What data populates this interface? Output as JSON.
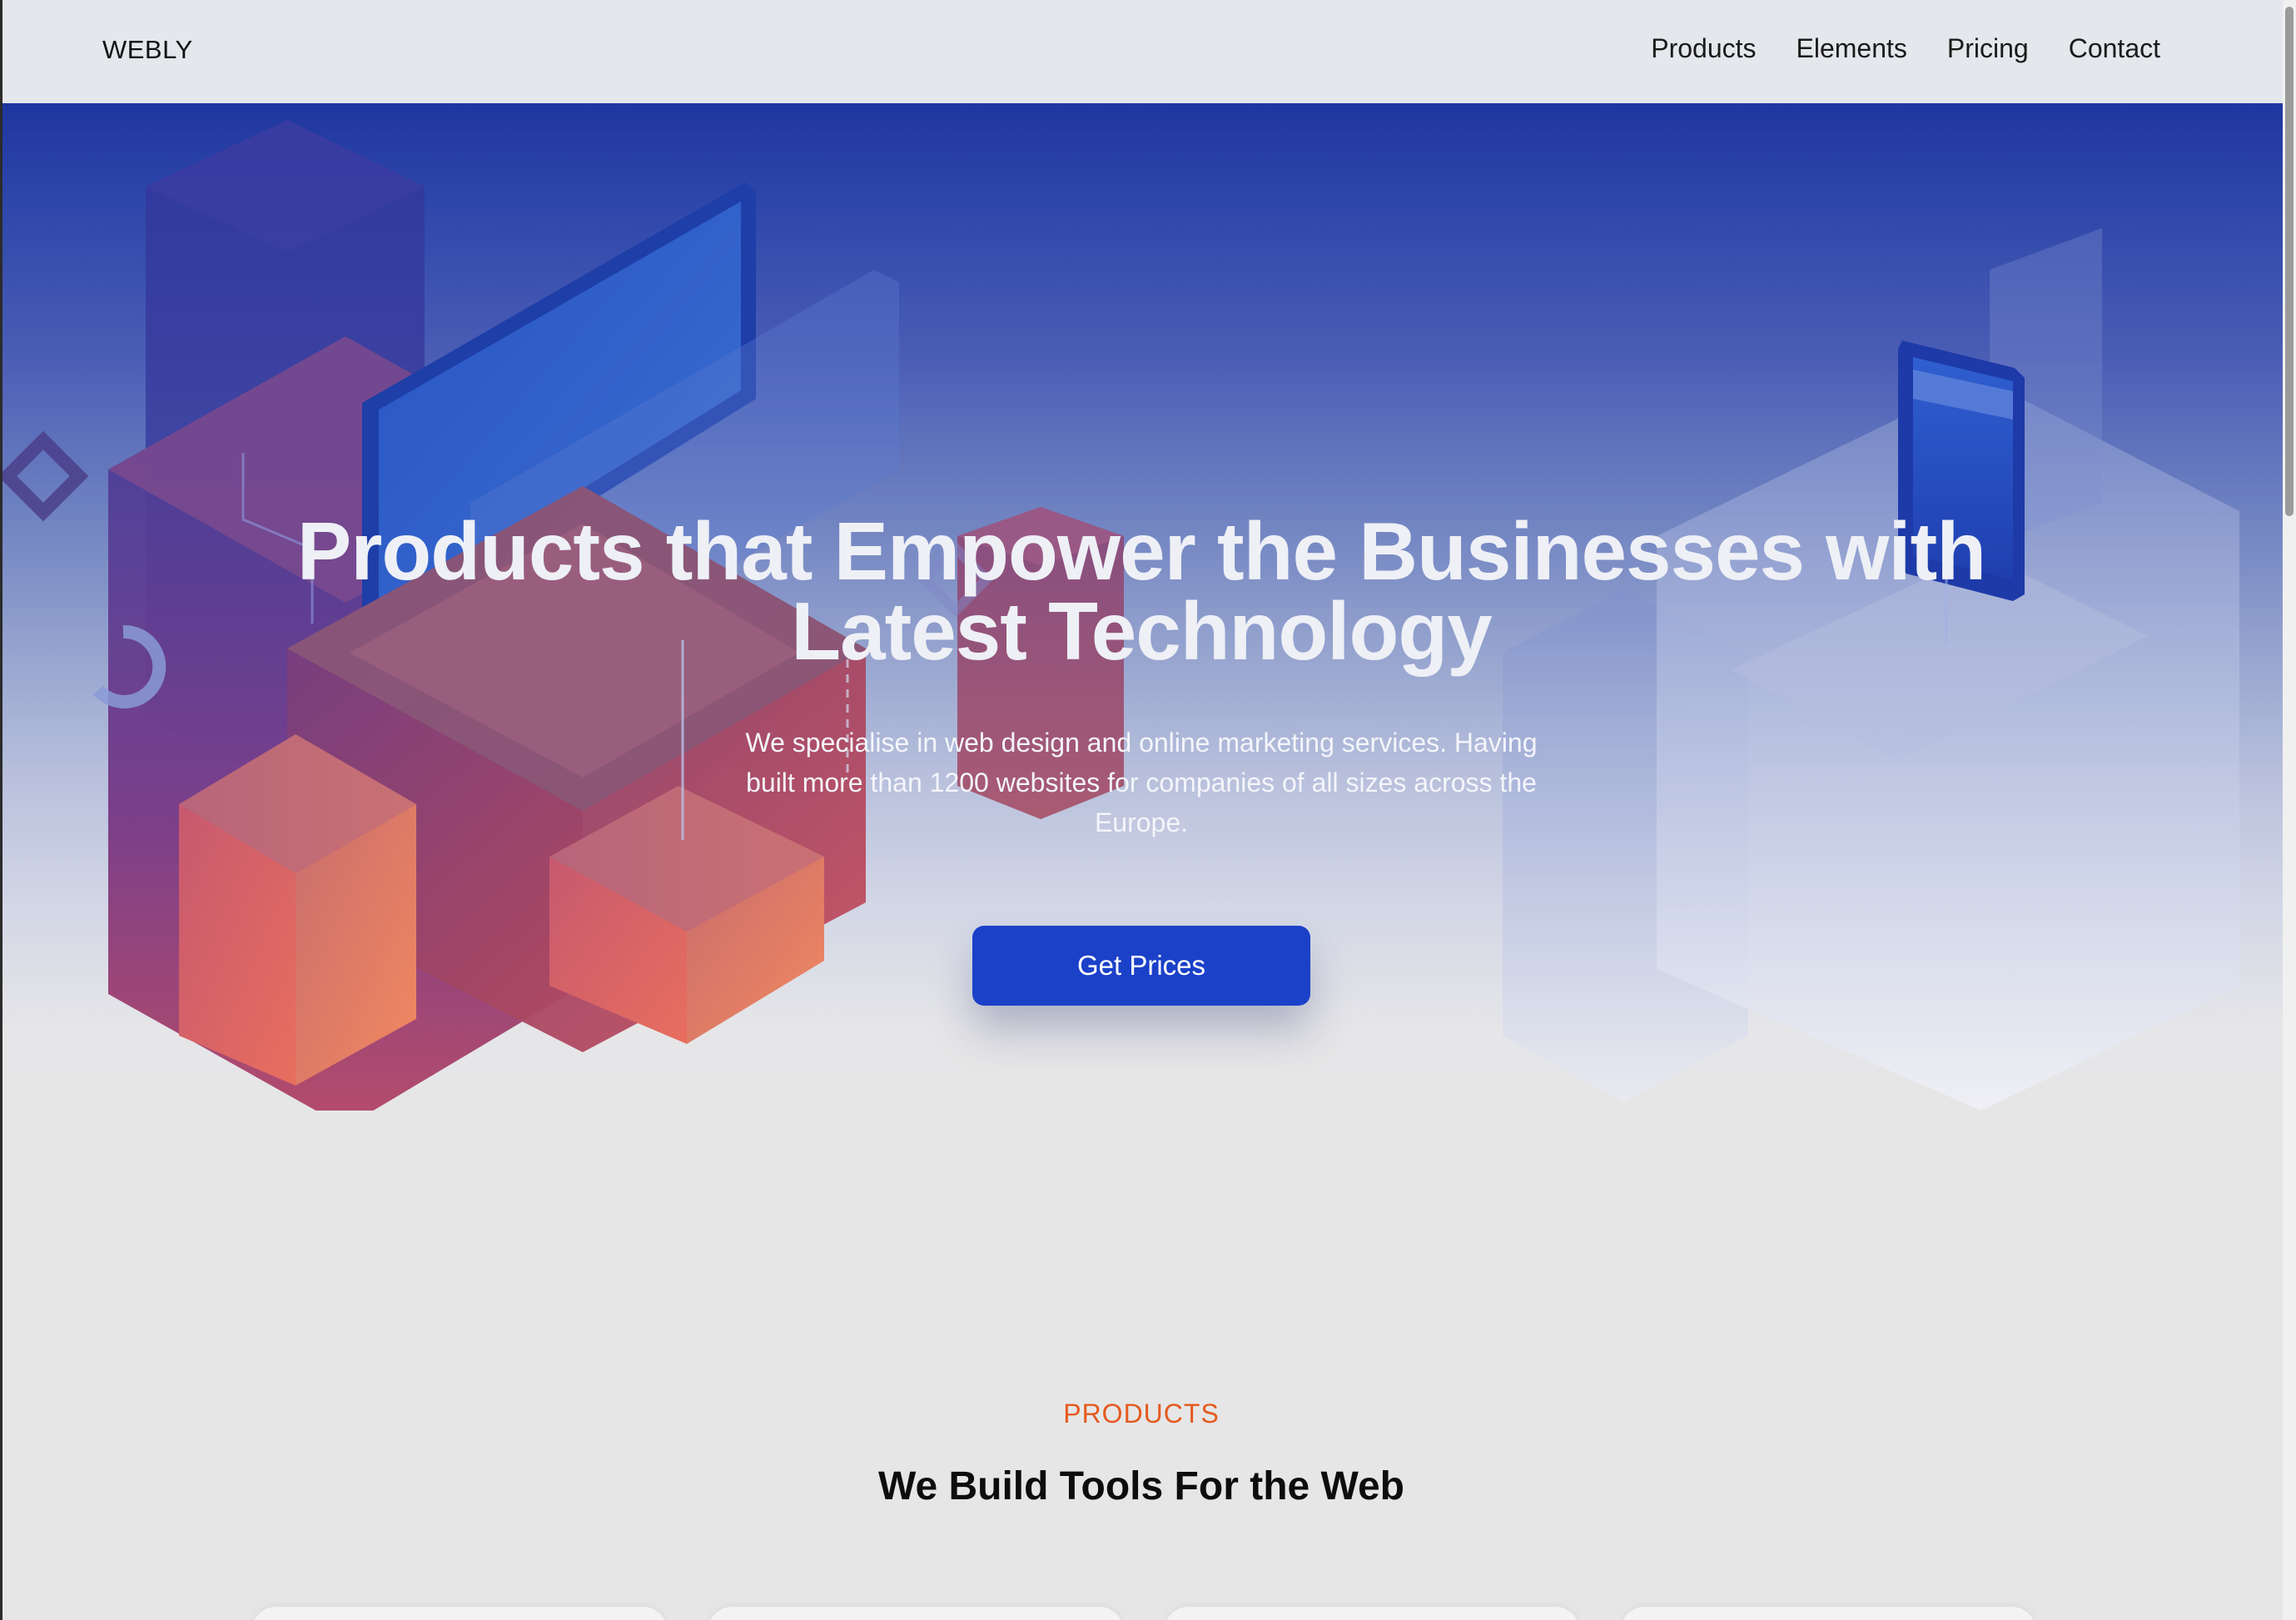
{
  "header": {
    "logo": "WEBLY",
    "nav": [
      {
        "label": "Products"
      },
      {
        "label": "Elements"
      },
      {
        "label": "Pricing"
      },
      {
        "label": "Contact"
      }
    ]
  },
  "hero": {
    "title_line1": "Products that Empower the Businesses with",
    "title_line2": "Latest Technology",
    "subtitle": "We specialise in web design and online marketing services. Having built more than 1200 websites for companies of all sizes across the Europe.",
    "cta_label": "Get Prices"
  },
  "products": {
    "eyebrow": "PRODUCTS",
    "title": "We Build Tools For the Web"
  },
  "colors": {
    "cta": "#1b41c9",
    "eyebrow": "#e55a1f",
    "hero_top": "#1f36a0"
  }
}
